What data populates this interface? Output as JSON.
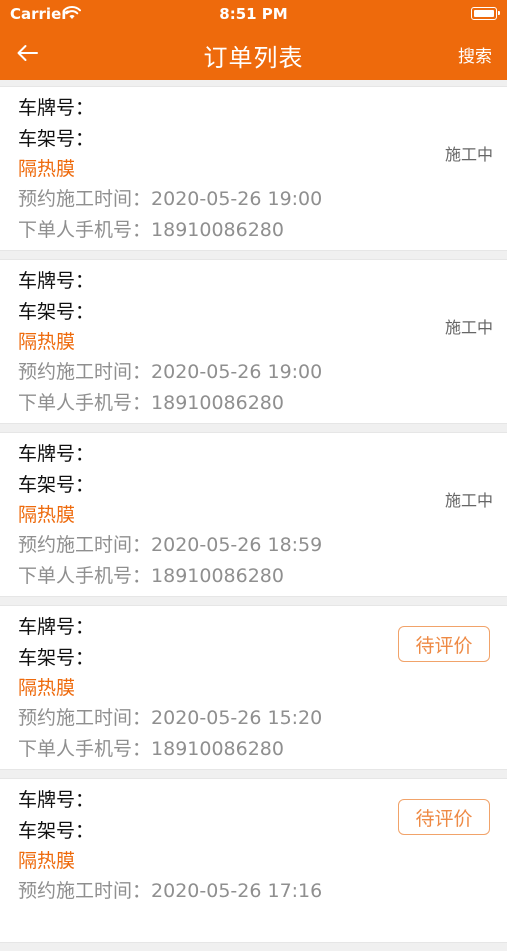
{
  "status_bar": {
    "carrier": "Carrier",
    "time": "8:51 PM"
  },
  "nav": {
    "title": "订单列表",
    "search_label": "搜索"
  },
  "labels": {
    "plate": "车牌号：",
    "frame": "车架号：",
    "appointment": "预约施工时间：",
    "phone": "下单人手机号："
  },
  "orders": [
    {
      "product": "隔热膜",
      "appointment_time": "2020-05-26 19:00",
      "phone": "18910086280",
      "status": "施工中",
      "status_type": "text"
    },
    {
      "product": "隔热膜",
      "appointment_time": "2020-05-26 19:00",
      "phone": "18910086280",
      "status": "施工中",
      "status_type": "text"
    },
    {
      "product": "隔热膜",
      "appointment_time": "2020-05-26 18:59",
      "phone": "18910086280",
      "status": "施工中",
      "status_type": "text"
    },
    {
      "product": "隔热膜",
      "appointment_time": "2020-05-26 15:20",
      "phone": "18910086280",
      "status": "待评价",
      "status_type": "button"
    },
    {
      "product": "隔热膜",
      "appointment_time": "2020-05-26 17:16",
      "phone": "",
      "status": "待评价",
      "status_type": "button"
    }
  ],
  "colors": {
    "brand": "#ee6a0c",
    "secondary_text": "#8f8f8f",
    "button_border": "#f1a36a"
  }
}
